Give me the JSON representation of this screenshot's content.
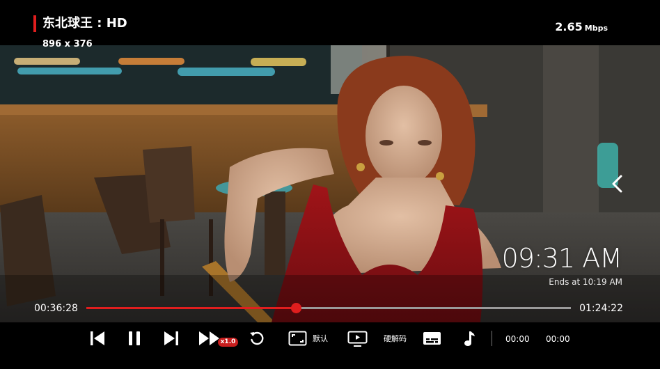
{
  "header": {
    "title": "东北球王 : HD",
    "resolution": "896 x 376",
    "bitrate_value": "2.65",
    "bitrate_unit": "Mbps"
  },
  "overlay": {
    "clock": "09:31 AM",
    "ends_at": "Ends at 10:19 AM"
  },
  "playback": {
    "current_time": "00:36:28",
    "total_time": "01:24:22",
    "progress_fraction": 0.432
  },
  "controls": {
    "speed_label": "x1.0",
    "aspect_label": "默认",
    "decoder_label": "硬解码",
    "time_a": "00:00",
    "time_b": "00:00"
  },
  "icons": [
    "skip-previous-icon",
    "pause-icon",
    "skip-next-icon",
    "fast-forward-icon",
    "replay-icon",
    "aspect-ratio-icon",
    "decoder-icon",
    "subtitles-icon",
    "music-note-icon",
    "chevron-left-icon"
  ],
  "colors": {
    "accent": "#e01e1e",
    "track": "#9a9a9a",
    "background": "#000000"
  }
}
